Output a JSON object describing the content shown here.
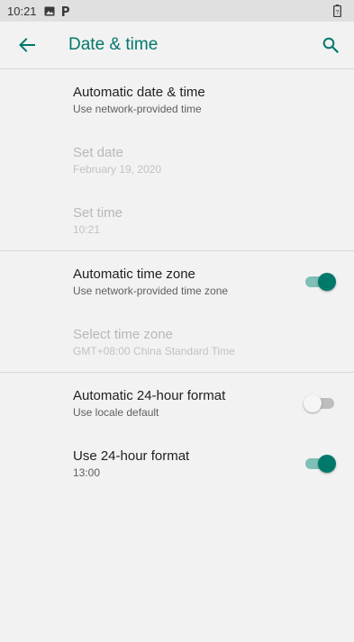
{
  "status_bar": {
    "time": "10:21",
    "icons": [
      "image-icon",
      "parking-icon",
      "battery-icon"
    ]
  },
  "app_bar": {
    "title": "Date & time",
    "back_icon": "arrow-back-icon",
    "search_icon": "search-icon"
  },
  "colors": {
    "accent": "#00796b",
    "background": "#f2f2f2",
    "switch_track_on": "#7fbfb5"
  },
  "settings": {
    "auto_date_time": {
      "title": "Automatic date & time",
      "summary": "Use network-provided time"
    },
    "set_date": {
      "title": "Set date",
      "summary": "February 19, 2020"
    },
    "set_time": {
      "title": "Set time",
      "summary": "10:21"
    },
    "auto_time_zone": {
      "title": "Automatic time zone",
      "summary": "Use network-provided time zone",
      "enabled": true
    },
    "select_time_zone": {
      "title": "Select time zone",
      "summary": "GMT+08:00 China Standard Time"
    },
    "auto_24h": {
      "title": "Automatic 24-hour format",
      "summary": "Use locale default",
      "enabled": false
    },
    "use_24h": {
      "title": "Use 24-hour format",
      "summary": "13:00",
      "enabled": true
    }
  }
}
